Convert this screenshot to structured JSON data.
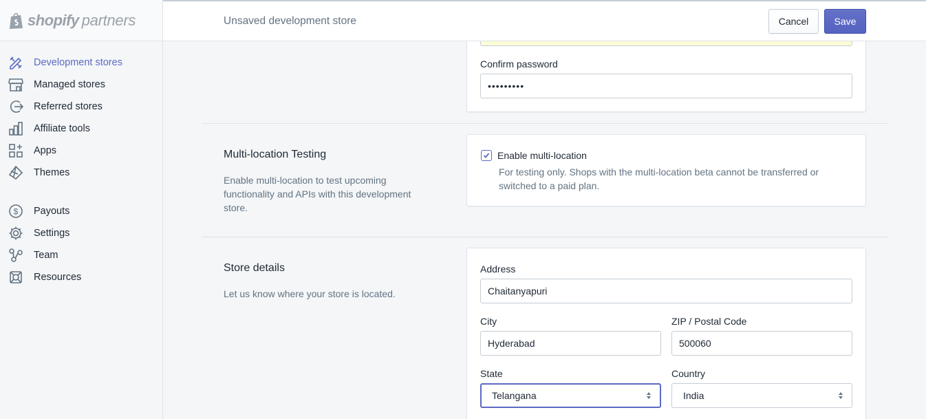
{
  "brand": {
    "name": "shopify",
    "suffix": "partners"
  },
  "sidebar": {
    "items": [
      {
        "label": "Development stores",
        "icon": "development-stores-icon",
        "active": true
      },
      {
        "label": "Managed stores",
        "icon": "storefront-icon"
      },
      {
        "label": "Referred stores",
        "icon": "referral-icon"
      },
      {
        "label": "Affiliate tools",
        "icon": "bar-chart-icon"
      },
      {
        "label": "Apps",
        "icon": "apps-icon"
      },
      {
        "label": "Themes",
        "icon": "themes-icon"
      }
    ],
    "items2": [
      {
        "label": "Payouts",
        "icon": "dollar-icon"
      },
      {
        "label": "Settings",
        "icon": "gear-icon"
      },
      {
        "label": "Team",
        "icon": "team-icon"
      },
      {
        "label": "Resources",
        "icon": "resources-icon"
      }
    ]
  },
  "topbar": {
    "title": "Unsaved development store",
    "cancel_label": "Cancel",
    "save_label": "Save"
  },
  "password_section": {
    "confirm_label": "Confirm password",
    "confirm_value": "•••••••••"
  },
  "multilocation": {
    "title": "Multi-location Testing",
    "description": "Enable multi-location to test upcoming functionality and APIs with this development store.",
    "checkbox_label": "Enable multi-location",
    "checked": true,
    "help_line1": "For testing only. Shops with the multi-location beta cannot be transferred or",
    "help_line2": "switched to a paid plan."
  },
  "store_details": {
    "title": "Store details",
    "description": "Let us know where your store is located.",
    "address_label": "Address",
    "address_value": "Chaitanyapuri",
    "city_label": "City",
    "city_value": "Hyderabad",
    "zip_label": "ZIP / Postal Code",
    "zip_value": "500060",
    "state_label": "State",
    "state_value": "Telangana",
    "country_label": "Country",
    "country_value": "India"
  },
  "colors": {
    "accent": "#5c6ac4",
    "text": "#212b36",
    "subdued": "#637381",
    "border": "#dfe3e8"
  }
}
